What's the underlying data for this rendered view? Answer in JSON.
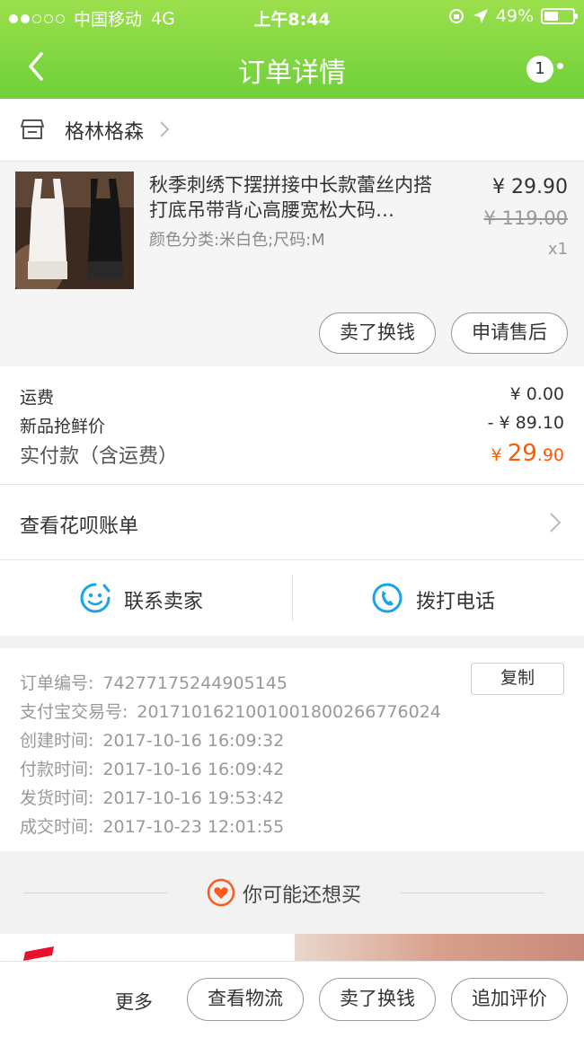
{
  "status_bar": {
    "carrier": "中国移动",
    "network": "4G",
    "time": "上午8:44",
    "battery": "49%",
    "battery_level": 0.49
  },
  "nav": {
    "title": "订单详情",
    "badge": "1"
  },
  "shop": {
    "name": "格林格森"
  },
  "product": {
    "name": "秋季刺绣下摆拼接中长款蕾丝内搭打底吊带背心高腰宽松大码…",
    "spec": "颜色分类:米白色;尺码:M",
    "price": "¥ 29.90",
    "original_price": "¥ 119.00",
    "quantity": "x1",
    "buttons": [
      "卖了换钱",
      "申请售后"
    ]
  },
  "fees": {
    "shipping_label": "运费",
    "shipping_value": "¥ 0.00",
    "discount_label": "新品抢鲜价",
    "discount_value": "- ¥ 89.10",
    "paid_label": "实付款（含运费）",
    "paid_currency": "¥ ",
    "paid_integer": "29",
    "paid_decimal": ".90"
  },
  "huabei": {
    "label": "查看花呗账单"
  },
  "contact": {
    "seller_label": "联系卖家",
    "phone_label": "拨打电话"
  },
  "order_info": {
    "copy_label": "复制",
    "rows": [
      {
        "label": "订单编号:",
        "value": "74277175244905145"
      },
      {
        "label": "支付宝交易号:",
        "value": "2017101621001001800266776024"
      },
      {
        "label": "创建时间:",
        "value": "2017-10-16 16:09:32"
      },
      {
        "label": "付款时间:",
        "value": "2017-10-16 16:09:42"
      },
      {
        "label": "发货时间:",
        "value": "2017-10-16 19:53:42"
      },
      {
        "label": "成交时间:",
        "value": "2017-10-23 12:01:55"
      }
    ]
  },
  "recommend": {
    "label": "你可能还想买"
  },
  "bottom_bar": {
    "more": "更多",
    "buttons": [
      "查看物流",
      "卖了换钱",
      "追加评价"
    ]
  },
  "colors": {
    "header_green": "#76d33e",
    "price_orange": "#ff5a00",
    "icon_blue": "#1aa3e8"
  }
}
